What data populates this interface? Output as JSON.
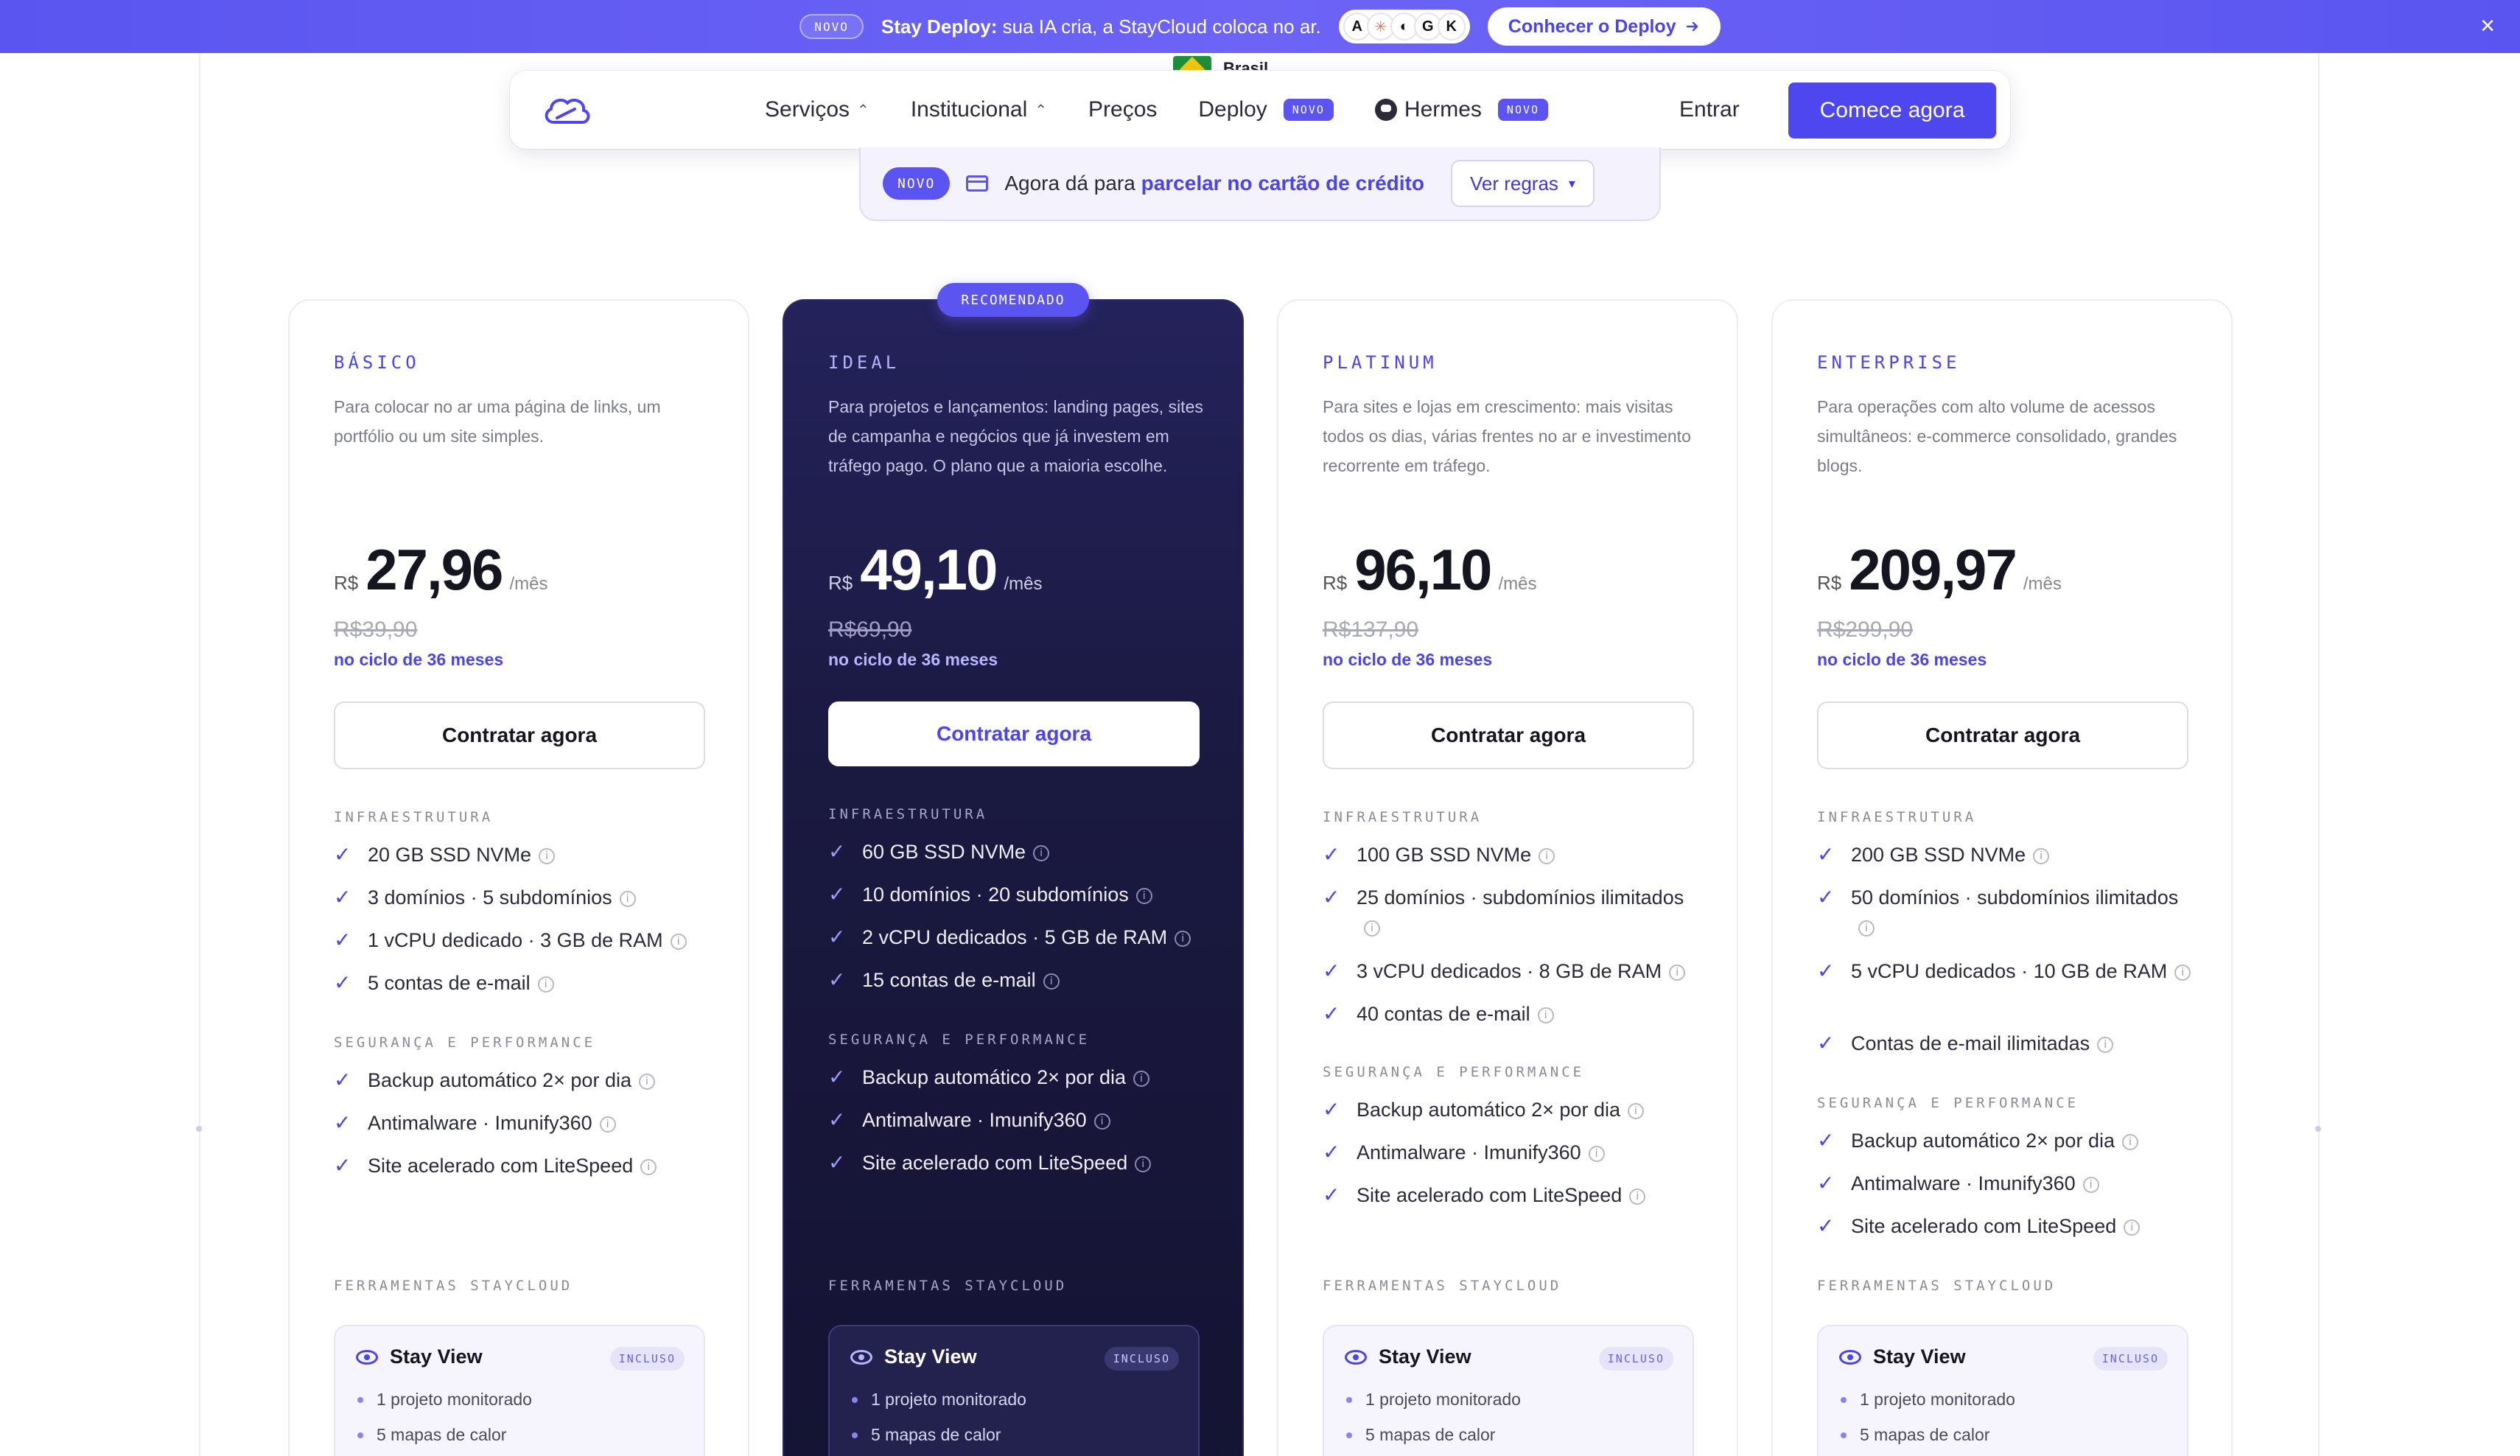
{
  "announcement": {
    "badge": "NOVO",
    "brand": "Stay Deploy:",
    "message": "sua IA cria, a StayCloud coloca no ar.",
    "logos": [
      "A",
      "✳",
      "◐",
      "G",
      "K"
    ],
    "cta": "Conhecer o Deploy",
    "cta_icon": "arrow-right-icon",
    "close": "×"
  },
  "region": {
    "label": "Brasil"
  },
  "nav": {
    "items": [
      {
        "label": "Serviços",
        "chevron": true
      },
      {
        "label": "Institucional",
        "chevron": true
      },
      {
        "label": "Preços"
      },
      {
        "label": "Deploy",
        "badge": "NOVO"
      },
      {
        "label": "Hermes",
        "badge": "NOVO",
        "icon": "hermes-icon"
      }
    ],
    "login": "Entrar",
    "cta": "Comece agora"
  },
  "notice": {
    "badge": "NOVO",
    "text": "Agora dá para ",
    "highlight": "parcelar no cartão de crédito",
    "button": "Ver regras"
  },
  "recommended_badge": "RECOMENDADO",
  "plans": [
    {
      "name": "BÁSICO",
      "desc": "Para colocar no ar uma página de links, um portfólio ou um site simples.",
      "currency": "R$",
      "price": "27,96",
      "period": "/mês",
      "old_price": "R$39,90",
      "cycle": "no ciclo de 36 meses",
      "button": "Contratar agora",
      "infra_label": "INFRAESTRUTURA",
      "infra": [
        "20 GB SSD NVMe",
        "3 domínios · 5 subdomínios",
        "1 vCPU dedicado · 3 GB de RAM",
        "5 contas de e-mail"
      ],
      "security_label": "SEGURANÇA E PERFORMANCE",
      "security": [
        "Backup automático 2× por dia",
        "Antimalware · Imunify360",
        "Site acelerado com LiteSpeed"
      ],
      "tools_label": "FERRAMENTAS STAYCLOUD",
      "tool": {
        "name": "Stay View",
        "badge": "INCLUSO",
        "items": [
          "1 projeto monitorado",
          "5 mapas de calor"
        ]
      }
    },
    {
      "name": "IDEAL",
      "desc": "Para projetos e lançamentos: landing pages, sites de campanha e negócios que já investem em tráfego pago. O plano que a maioria escolhe.",
      "currency": "R$",
      "price": "49,10",
      "period": "/mês",
      "old_price": "R$69,90",
      "cycle": "no ciclo de 36 meses",
      "button": "Contratar agora",
      "infra_label": "INFRAESTRUTURA",
      "infra": [
        "60 GB SSD NVMe",
        "10 domínios · 20 subdomínios",
        "2 vCPU dedicados · 5 GB de RAM",
        "15 contas de e-mail"
      ],
      "security_label": "SEGURANÇA E PERFORMANCE",
      "security": [
        "Backup automático 2× por dia",
        "Antimalware · Imunify360",
        "Site acelerado com LiteSpeed"
      ],
      "tools_label": "FERRAMENTAS STAYCLOUD",
      "tool": {
        "name": "Stay View",
        "badge": "INCLUSO",
        "items": [
          "1 projeto monitorado",
          "5 mapas de calor"
        ]
      }
    },
    {
      "name": "PLATINUM",
      "desc": "Para sites e lojas em crescimento: mais visitas todos os dias, várias frentes no ar e investimento recorrente em tráfego.",
      "currency": "R$",
      "price": "96,10",
      "period": "/mês",
      "old_price": "R$137,90",
      "cycle": "no ciclo de 36 meses",
      "button": "Contratar agora",
      "infra_label": "INFRAESTRUTURA",
      "infra": [
        "100 GB SSD NVMe",
        "25 domínios · subdomínios ilimitados",
        "3 vCPU dedicados · 8 GB de RAM",
        "40 contas de e-mail"
      ],
      "security_label": "SEGURANÇA E PERFORMANCE",
      "security": [
        "Backup automático 2× por dia",
        "Antimalware · Imunify360",
        "Site acelerado com LiteSpeed"
      ],
      "tools_label": "FERRAMENTAS STAYCLOUD",
      "tool": {
        "name": "Stay View",
        "badge": "INCLUSO",
        "items": [
          "1 projeto monitorado",
          "5 mapas de calor"
        ]
      }
    },
    {
      "name": "ENTERPRISE",
      "desc": "Para operações com alto volume de acessos simultâneos: e-commerce consolidado, grandes blogs.",
      "currency": "R$",
      "price": "209,97",
      "period": "/mês",
      "old_price": "R$299,90",
      "cycle": "no ciclo de 36 meses",
      "button": "Contratar agora",
      "infra_label": "INFRAESTRUTURA",
      "infra": [
        "200 GB SSD NVMe",
        "50 domínios · subdomínios ilimitados",
        "5 vCPU dedicados · 10 GB de RAM",
        "Contas de e-mail ilimitadas"
      ],
      "security_label": "SEGURANÇA E PERFORMANCE",
      "security": [
        "Backup automático 2× por dia",
        "Antimalware · Imunify360",
        "Site acelerado com LiteSpeed"
      ],
      "tools_label": "FERRAMENTAS STAYCLOUD",
      "tool": {
        "name": "Stay View",
        "badge": "INCLUSO",
        "items": [
          "1 projeto monitorado",
          "5 mapas de calor"
        ]
      }
    }
  ],
  "colors": {
    "accent": "#4e47ef",
    "dark_card": "#1a1940",
    "banner": "#5a55f0"
  }
}
